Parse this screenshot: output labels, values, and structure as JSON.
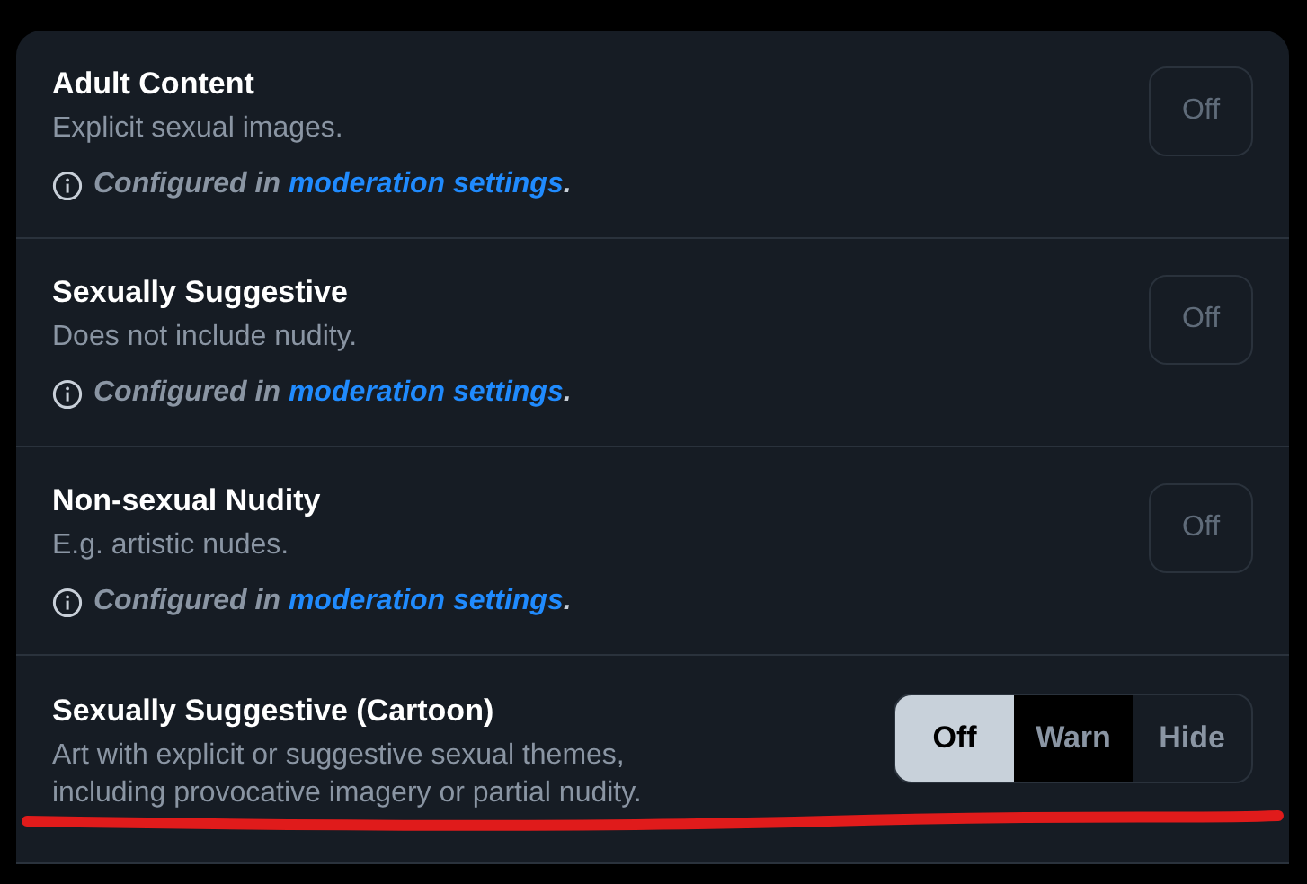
{
  "settings": [
    {
      "kind": "locked",
      "title": "Adult Content",
      "description": "Explicit sexual images.",
      "note": "Configured in",
      "link": "moderation settings",
      "note_end": ".",
      "button": "Off"
    },
    {
      "kind": "locked",
      "title": "Sexually Suggestive",
      "description": "Does not include nudity.",
      "note": "Configured in",
      "link": "moderation settings",
      "note_end": ".",
      "button": "Off"
    },
    {
      "kind": "locked",
      "title": "Non-sexual Nudity",
      "description": "E.g. artistic nudes.",
      "note": "Configured in",
      "link": "moderation settings",
      "note_end": ".",
      "button": "Off"
    },
    {
      "kind": "choice",
      "title": "Sexually Suggestive (Cartoon)",
      "description": "Art with explicit or suggestive sexual themes, including provocative imagery or partial nudity.",
      "underlined": true,
      "options": [
        {
          "label": "Off",
          "selected": true,
          "hovered": false
        },
        {
          "label": "Warn",
          "selected": false,
          "hovered": true
        },
        {
          "label": "Hide",
          "selected": false,
          "hovered": false
        }
      ]
    }
  ]
}
